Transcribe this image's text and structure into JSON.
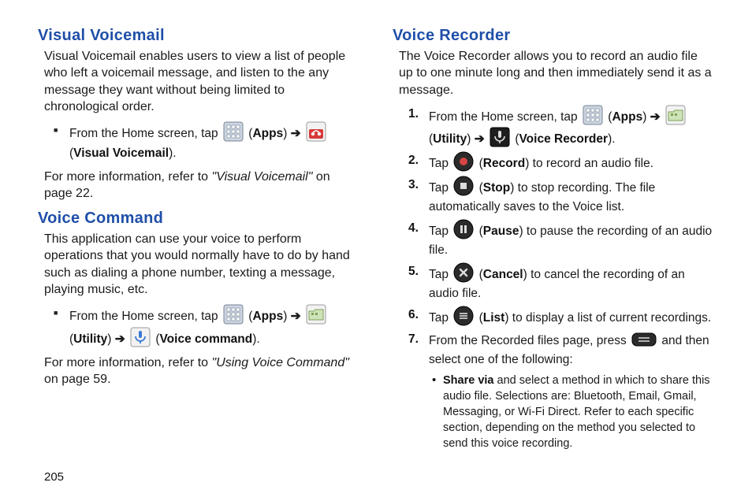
{
  "left": {
    "visualVoicemail": {
      "heading": "Visual Voicemail",
      "intro": "Visual Voicemail enables users to view a list of people who left a voicemail message, and listen to the any message they want without being limited to chronological order.",
      "step_pre": "From the Home screen, tap ",
      "apps_label": "Apps",
      "arrow": " ➔ ",
      "vv_label": "Visual Voicemail",
      "ref_pre": "For more information, refer to ",
      "ref_title": "\"Visual Voicemail\"",
      "ref_post": "  on page 22."
    },
    "voiceCommand": {
      "heading": "Voice Command",
      "intro": "This application can use your voice to perform operations that you would normally have to do by hand such as dialing a phone number, texting a message, playing music, etc.",
      "step_pre": "From the Home screen, tap ",
      "apps_label": "Apps",
      "arrow": " ➔ ",
      "utility_label": "Utility",
      "vc_label": "Voice command",
      "ref_pre": "For more information, refer to ",
      "ref_title": "\"Using Voice Command\"",
      "ref_post": "  on page 59."
    }
  },
  "right": {
    "heading": "Voice Recorder",
    "intro": "The Voice Recorder allows you to record an audio file up to one minute long and then immediately send it as a message.",
    "steps": {
      "s1_pre": "From the Home screen, tap ",
      "s1_apps": "Apps",
      "s1_arrow": " ➔ ",
      "s1_util": "Utility",
      "s1_vr": "Voice Recorder",
      "s2_pre": "Tap ",
      "s2_label": "Record",
      "s2_post": ") to record an audio file.",
      "s3_pre": "Tap ",
      "s3_label": "Stop",
      "s3_post": ") to stop recording. The file automatically saves to the Voice list.",
      "s4_pre": "Tap ",
      "s4_label": "Pause",
      "s4_post": ") to pause the recording of an audio file.",
      "s5_pre": "Tap ",
      "s5_label": "Cancel",
      "s5_post": ") to cancel the recording of an audio file.",
      "s6_pre": "Tap ",
      "s6_label": "List",
      "s6_post": ") to display a list of current recordings.",
      "s7_pre": "From the Recorded files page, press ",
      "s7_post": " and then select one of the following:",
      "sub_label": "Share via",
      "sub_rest": " and select a method in which to share this audio file. Selections are: Bluetooth, Email, Gmail, Messaging, or Wi-Fi Direct. Refer to each specific section, depending on the method you selected to send this voice recording."
    }
  },
  "pageNumber": "205"
}
